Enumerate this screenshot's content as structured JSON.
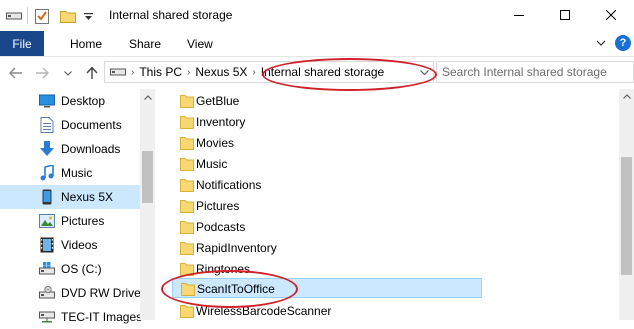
{
  "window": {
    "title": "Internal shared storage",
    "icons": [
      "drive-icon",
      "properties-icon",
      "new-folder-icon",
      "customize-dropdown-icon"
    ],
    "controls": [
      "minimize-icon",
      "maximize-icon",
      "close-icon"
    ]
  },
  "ribbon": {
    "tabs": [
      {
        "label": "File"
      },
      {
        "label": "Home"
      },
      {
        "label": "Share"
      },
      {
        "label": "View"
      }
    ],
    "help": "?",
    "colors": {
      "file_tab": "#19478a",
      "help": "#1a6fd6"
    }
  },
  "address": {
    "crumbs": [
      {
        "label": "This PC"
      },
      {
        "label": "Nexus 5X"
      },
      {
        "label": "Internal shared storage"
      }
    ],
    "search_placeholder": "Search Internal shared storage"
  },
  "sidebar": {
    "items": [
      {
        "label": "Desktop",
        "icon": "desktop-icon"
      },
      {
        "label": "Documents",
        "icon": "documents-icon"
      },
      {
        "label": "Downloads",
        "icon": "downloads-icon"
      },
      {
        "label": "Music",
        "icon": "music-icon"
      },
      {
        "label": "Nexus 5X",
        "icon": "phone-icon",
        "selected": true
      },
      {
        "label": "Pictures",
        "icon": "pictures-icon"
      },
      {
        "label": "Videos",
        "icon": "videos-icon"
      },
      {
        "label": "OS (C:)",
        "icon": "os-drive-icon"
      },
      {
        "label": "DVD RW Drive",
        "icon": "dvd-drive-icon"
      },
      {
        "label": "TEC-IT Images",
        "icon": "network-drive-icon"
      }
    ]
  },
  "files": {
    "items": [
      {
        "label": "GetBlue"
      },
      {
        "label": "Inventory"
      },
      {
        "label": "Movies"
      },
      {
        "label": "Music"
      },
      {
        "label": "Notifications"
      },
      {
        "label": "Pictures"
      },
      {
        "label": "Podcasts"
      },
      {
        "label": "RapidInventory"
      },
      {
        "label": "Ringtones"
      },
      {
        "label": "ScanItToOffice",
        "selected": true
      },
      {
        "label": "WirelessBarcodeScanner"
      }
    ],
    "colors": {
      "folder": "#f8d775",
      "selection": "#cce8ff",
      "annotation": "#d0212a"
    }
  }
}
